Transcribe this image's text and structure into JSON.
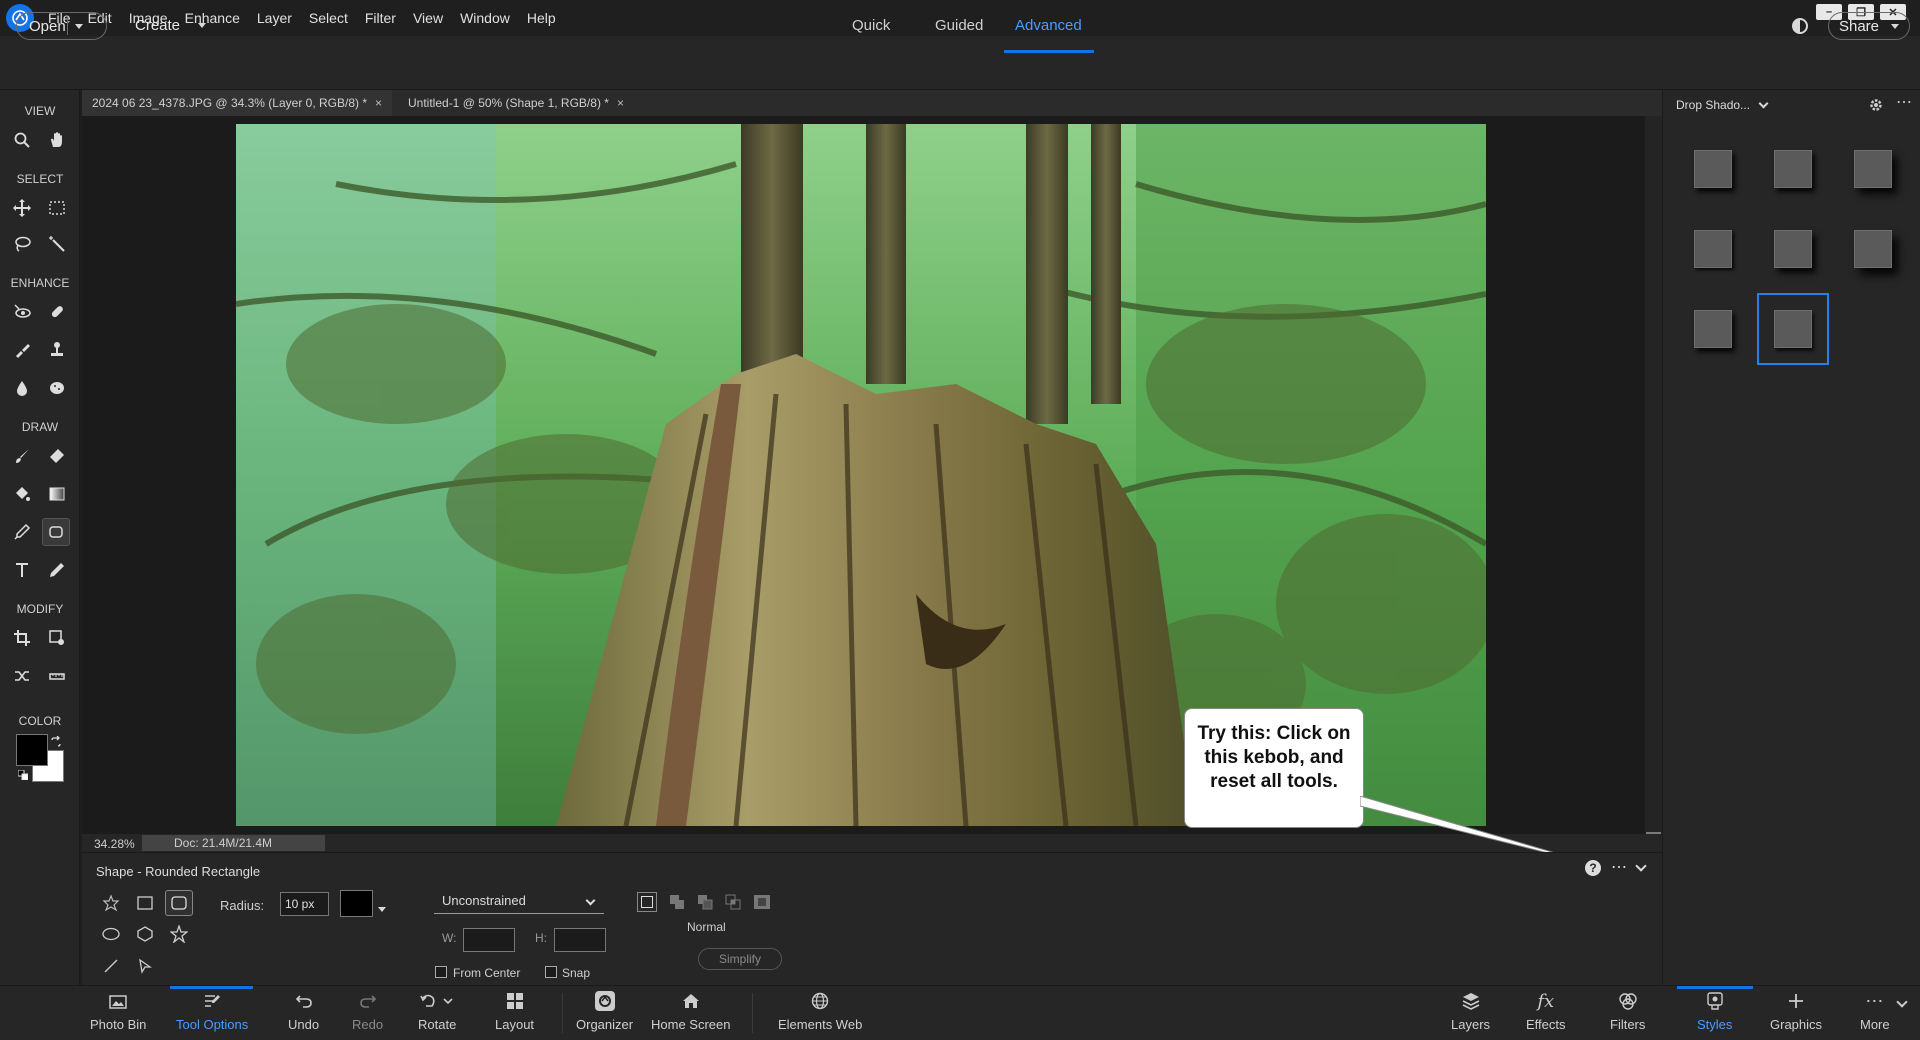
{
  "menubar": {
    "items": [
      "File",
      "Edit",
      "Image",
      "Enhance",
      "Layer",
      "Select",
      "Filter",
      "View",
      "Window",
      "Help"
    ]
  },
  "modebar": {
    "open_label": "Open",
    "create_label": "Create",
    "tabs": [
      "Quick",
      "Guided",
      "Advanced"
    ],
    "active_tab": "Advanced",
    "share_label": "Share"
  },
  "toolbox": {
    "sections": [
      "VIEW",
      "SELECT",
      "ENHANCE",
      "DRAW",
      "MODIFY",
      "COLOR"
    ]
  },
  "documents": {
    "tabs": [
      {
        "label": "2024 06 23_4378.JPG @ 34.3% (Layer 0, RGB/8) *"
      },
      {
        "label": "Untitled-1 @ 50% (Shape 1, RGB/8) *"
      }
    ]
  },
  "status": {
    "zoom": "34.28%",
    "doc_size": "Doc: 21.4M/21.4M"
  },
  "callout": {
    "text": "Try this:   Click on this kebob, and reset all tools."
  },
  "tool_options": {
    "title": "Shape - Rounded Rectangle",
    "radius_label": "Radius:",
    "radius_value": "10 px",
    "constraint_value": "Unconstrained",
    "w_label": "W:",
    "h_label": "H:",
    "blend_label": "Normal",
    "from_center_label": "From Center",
    "snap_label": "Snap",
    "simplify_label": "Simplify"
  },
  "styles_panel": {
    "category": "Drop Shado...",
    "swatch_count": 8,
    "selected_index": 7
  },
  "taskbar": {
    "left": [
      {
        "label": "Photo Bin",
        "icon": "photo-bin-icon"
      },
      {
        "label": "Tool Options",
        "icon": "tool-options-icon",
        "active": true
      },
      {
        "label": "Undo",
        "icon": "undo-icon"
      },
      {
        "label": "Redo",
        "icon": "redo-icon"
      },
      {
        "label": "Rotate",
        "icon": "rotate-icon"
      },
      {
        "label": "Layout",
        "icon": "layout-icon"
      },
      {
        "label": "Organizer",
        "icon": "organizer-icon"
      },
      {
        "label": "Home Screen",
        "icon": "home-icon"
      },
      {
        "label": "Elements Web",
        "icon": "globe-icon"
      }
    ],
    "right": [
      {
        "label": "Layers",
        "icon": "layers-icon"
      },
      {
        "label": "Effects",
        "icon": "fx-icon"
      },
      {
        "label": "Filters",
        "icon": "filters-icon"
      },
      {
        "label": "Styles",
        "icon": "styles-icon",
        "active": true
      },
      {
        "label": "Graphics",
        "icon": "plus-icon"
      },
      {
        "label": "More",
        "icon": "more-icon"
      }
    ]
  },
  "colors": {
    "accent": "#1473e6",
    "foreground": "#000000",
    "background": "#ffffff"
  }
}
